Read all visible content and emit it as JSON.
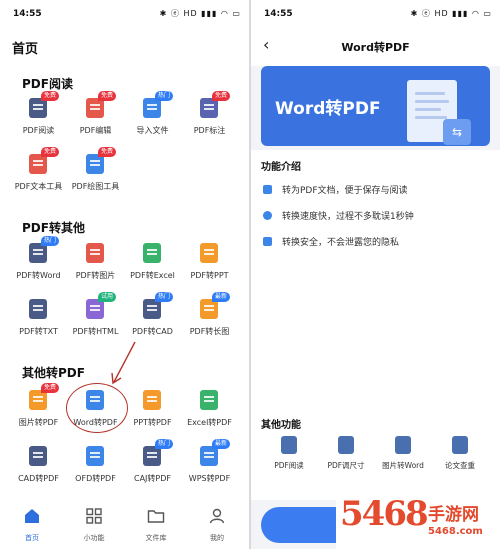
{
  "left": {
    "status_time": "14:55",
    "status_icons": "✱ ⓔ HD ▮▮▮ ◠ ▭",
    "page_title": "首页",
    "sections": [
      {
        "title": "PDF阅读",
        "tiles": [
          {
            "label": "PDF阅读",
            "badge": "免费",
            "color": "navy"
          },
          {
            "label": "PDF编辑",
            "badge": "免费",
            "color": "red"
          },
          {
            "label": "导入文件",
            "badge": "热门",
            "color": "blue"
          },
          {
            "label": "PDF标注",
            "badge": "免费",
            "color": "violet"
          },
          {
            "label": "PDF文本工具",
            "badge": "免费",
            "color": "red"
          },
          {
            "label": "PDF绘图工具",
            "badge": "免费",
            "color": "blue"
          }
        ]
      },
      {
        "title": "PDF转其他",
        "tiles": [
          {
            "label": "PDF转Word",
            "badge": "热门",
            "color": "navy"
          },
          {
            "label": "PDF转图片",
            "badge": "",
            "color": "red"
          },
          {
            "label": "PDF转Excel",
            "badge": "",
            "color": "green"
          },
          {
            "label": "PDF转PPT",
            "badge": "",
            "color": "orange"
          },
          {
            "label": "PDF转TXT",
            "badge": "",
            "color": "navy"
          },
          {
            "label": "PDF转HTML",
            "badge": "试用",
            "color": "purple"
          },
          {
            "label": "PDF转CAD",
            "badge": "热门",
            "color": "navy"
          },
          {
            "label": "PDF转长图",
            "badge": "最新",
            "color": "orange"
          }
        ]
      },
      {
        "title": "其他转PDF",
        "tiles": [
          {
            "label": "图片转PDF",
            "badge": "免费",
            "color": "orange"
          },
          {
            "label": "Word转PDF",
            "badge": "",
            "color": "blue"
          },
          {
            "label": "PPT转PDF",
            "badge": "",
            "color": "orange"
          },
          {
            "label": "Excel转PDF",
            "badge": "",
            "color": "green"
          },
          {
            "label": "CAD转PDF",
            "badge": "",
            "color": "navy"
          },
          {
            "label": "OFD转PDF",
            "badge": "",
            "color": "blue"
          },
          {
            "label": "CAJ转PDF",
            "badge": "热门",
            "color": "navy"
          },
          {
            "label": "WPS转PDF",
            "badge": "最新",
            "color": "blue"
          }
        ]
      }
    ],
    "tabs": [
      {
        "label": "首页",
        "icon": "home-icon",
        "active": true
      },
      {
        "label": "小功能",
        "icon": "grid-icon",
        "active": false
      },
      {
        "label": "文件库",
        "icon": "folder-icon",
        "active": false
      },
      {
        "label": "我的",
        "icon": "user-icon",
        "active": false
      }
    ]
  },
  "right": {
    "status_time": "14:55",
    "status_icons": "✱ ⓔ HD ▮▮▮ ◠ ▭",
    "title": "Word转PDF",
    "banner_text": "Word转PDF",
    "intro_title": "功能介绍",
    "features": [
      "转为PDF文档，便于保存与阅读",
      "转换速度快，过程不多耽误1秒钟",
      "转换安全，不会泄露您的隐私"
    ],
    "other_title": "其他功能",
    "other_funcs": [
      "PDF阅读",
      "PDF调尺寸",
      "图片转Word",
      "论文查重"
    ]
  },
  "watermark": {
    "number": "5468",
    "name": "手游网",
    "url": "5468.com"
  },
  "colors": {
    "navy": "#4a5a86",
    "red": "#e4574b",
    "blue": "#3b86e6",
    "violet": "#5a63b0",
    "green": "#39b36b",
    "orange": "#f39a2b",
    "purple": "#8b67d6",
    "accent": "#2e6fe0",
    "annotation": "#b5332a"
  }
}
